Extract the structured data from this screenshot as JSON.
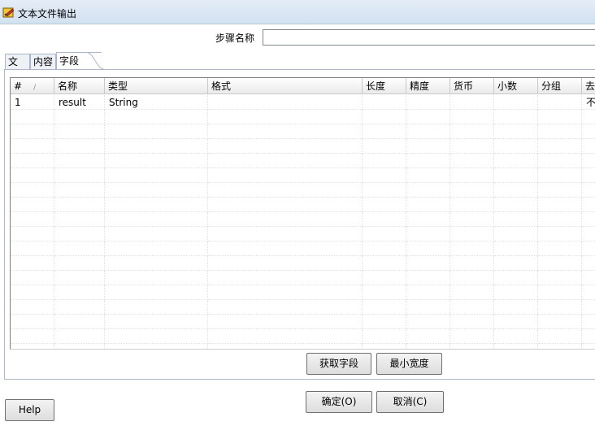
{
  "window": {
    "title": "文本文件输出"
  },
  "step": {
    "label": "步骤名称",
    "value": ""
  },
  "tabs": [
    {
      "label": "文件"
    },
    {
      "label": "内容"
    },
    {
      "label": "字段"
    }
  ],
  "grid": {
    "columns": [
      "#",
      "名称",
      "类型",
      "格式",
      "长度",
      "精度",
      "货币",
      "小数",
      "分组",
      "去"
    ],
    "rows": [
      {
        "num": "1",
        "name": "result",
        "type": "String",
        "format": "",
        "length": "",
        "precision": "",
        "currency": "",
        "decimal": "",
        "group": "",
        "trim": "不"
      }
    ]
  },
  "buttons": {
    "get_fields": "获取字段",
    "min_width": "最小宽度",
    "ok": "确定(O)",
    "cancel": "取消(C)",
    "help": "Help"
  },
  "colors": {
    "titlebar": "#d9e4f1",
    "header": "#eaeaea"
  }
}
